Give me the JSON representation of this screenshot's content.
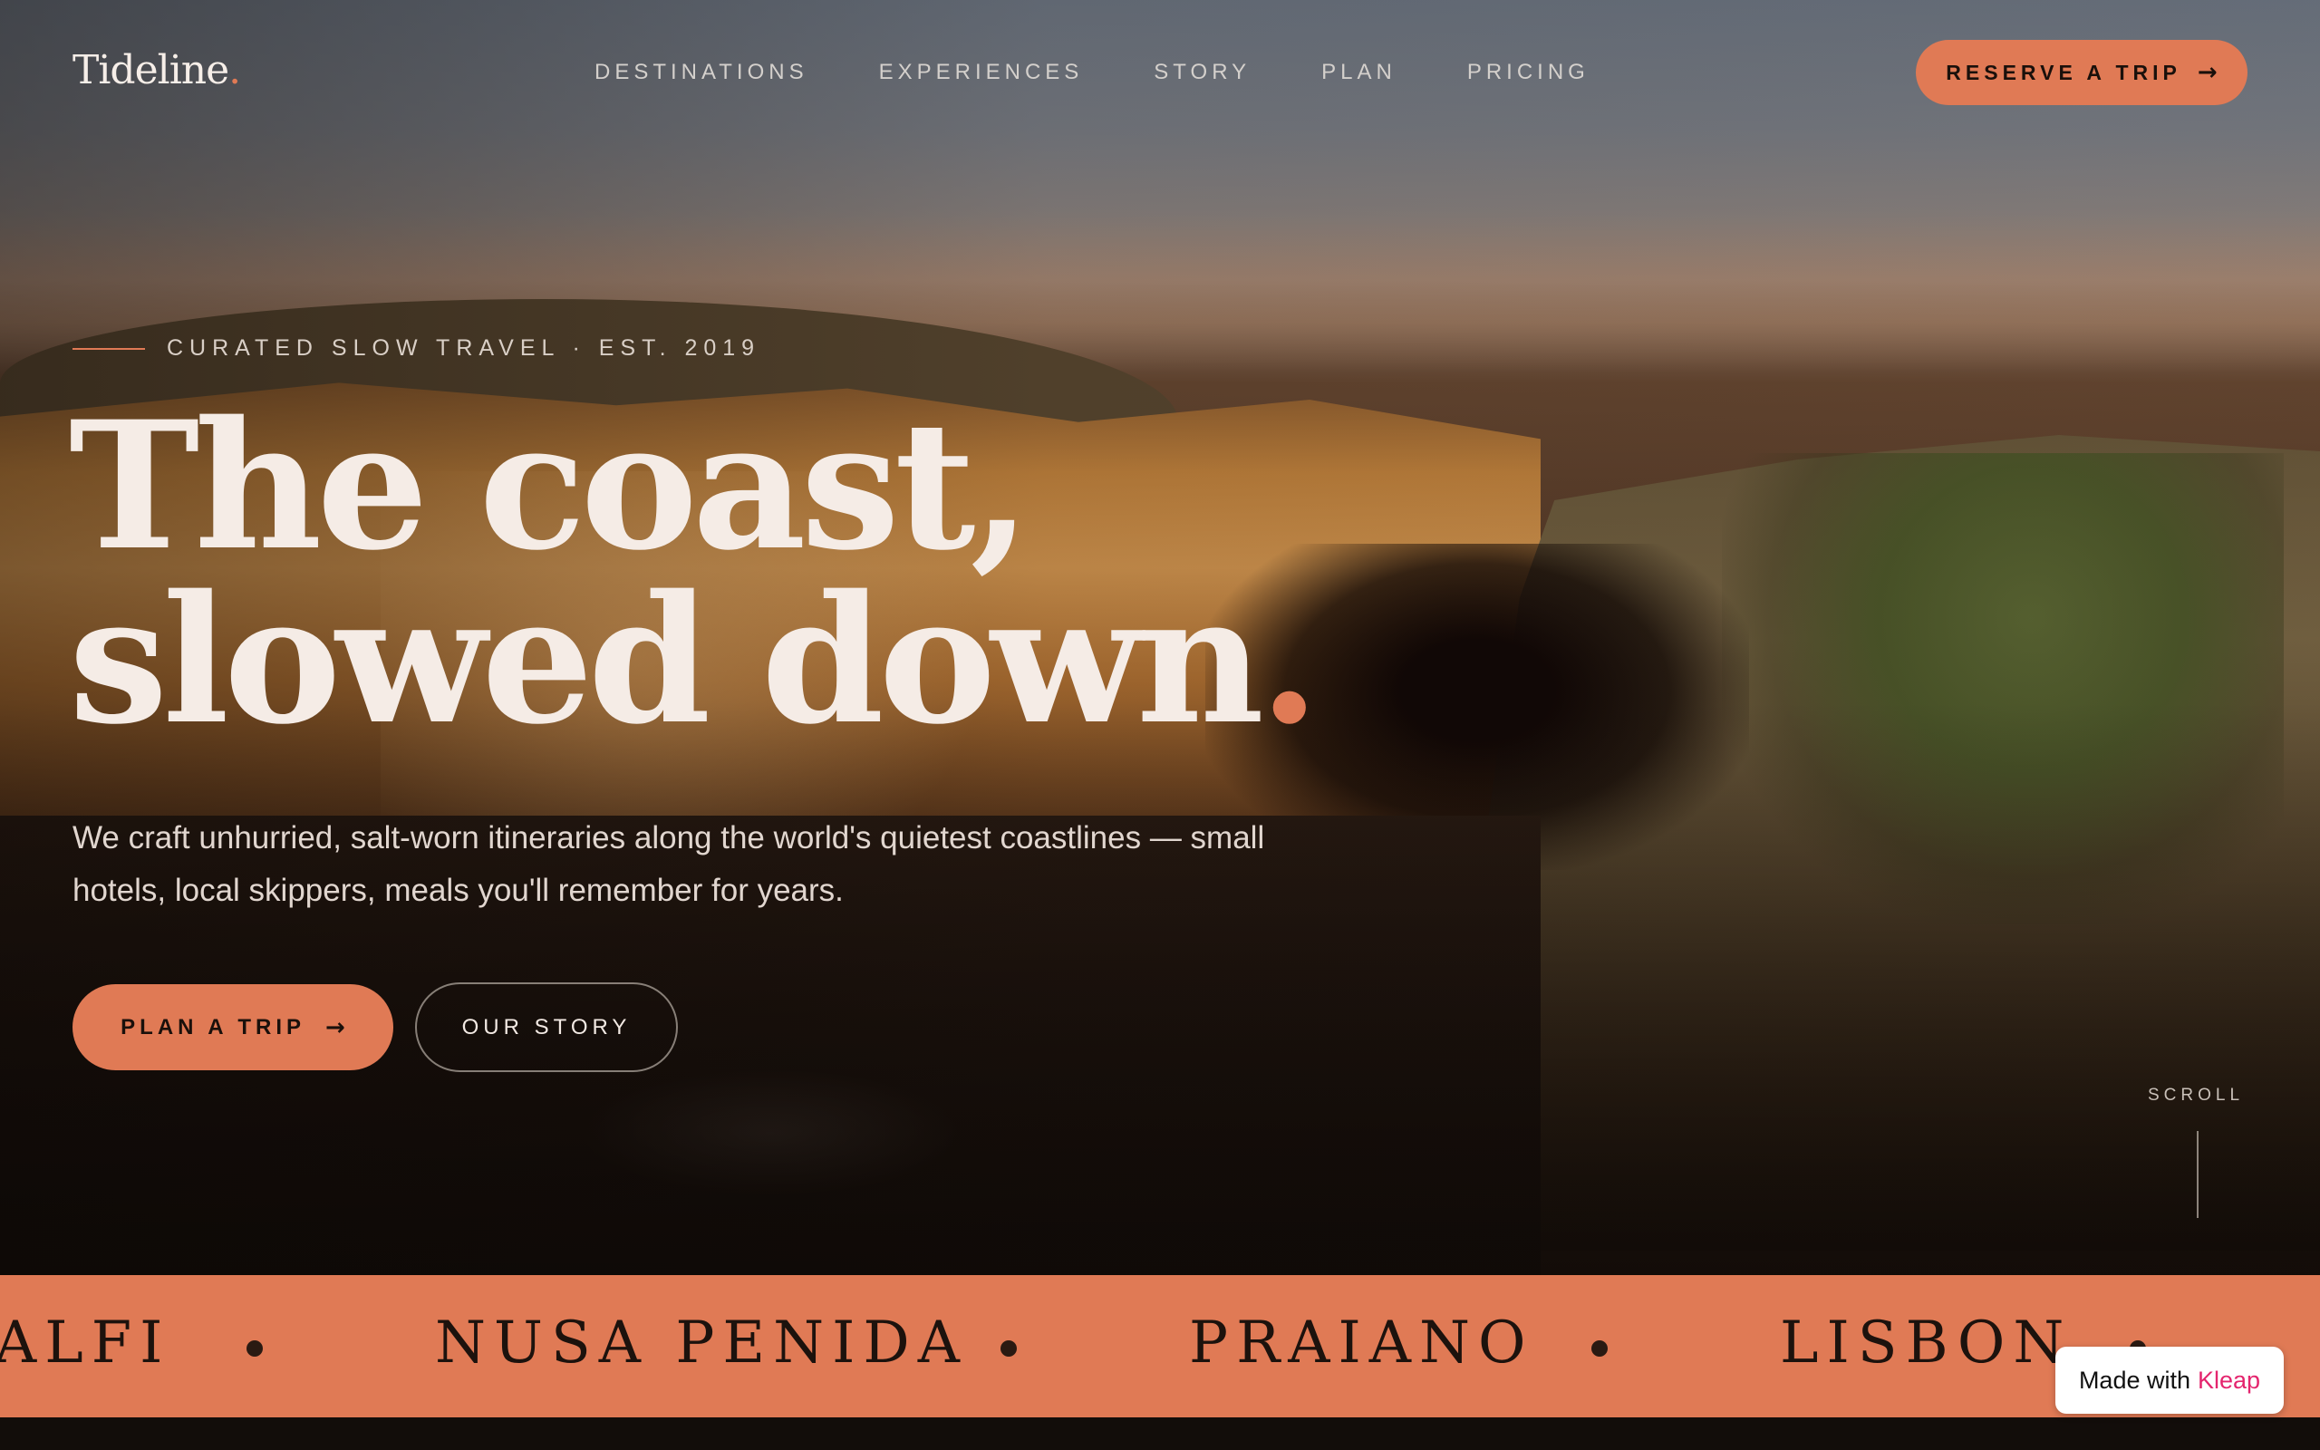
{
  "brand": {
    "name": "Tideline",
    "dot": "."
  },
  "nav": {
    "items": [
      {
        "label": "DESTINATIONS"
      },
      {
        "label": "EXPERIENCES"
      },
      {
        "label": "STORY"
      },
      {
        "label": "PLAN"
      },
      {
        "label": "PRICING"
      }
    ],
    "cta_label": "RESERVE A TRIP"
  },
  "hero": {
    "eyebrow": "CURATED SLOW TRAVEL · EST. 2019",
    "headline_line1": "The coast,",
    "headline_line2": "slowed down",
    "headline_dot": ".",
    "lede": "We craft unhurried, salt-worn itineraries along the world's quietest coastlines — small hotels, local skippers, meals you'll remember for years.",
    "primary_cta": "PLAN A TRIP",
    "secondary_cta": "OUR STORY",
    "scroll_label": "SCROLL"
  },
  "marquee": {
    "items": [
      "ALFI",
      "NUSA PENIDA",
      "PRAIANO",
      "LISBON"
    ]
  },
  "badge": {
    "prefix": "Made with",
    "brand": "Kleap"
  },
  "icons": {
    "arrow": "arrow-right-icon"
  },
  "colors": {
    "accent": "#e07a55",
    "ink": "#1a100b",
    "headline": "#f5ece6",
    "badge_brand": "#e4256e"
  }
}
